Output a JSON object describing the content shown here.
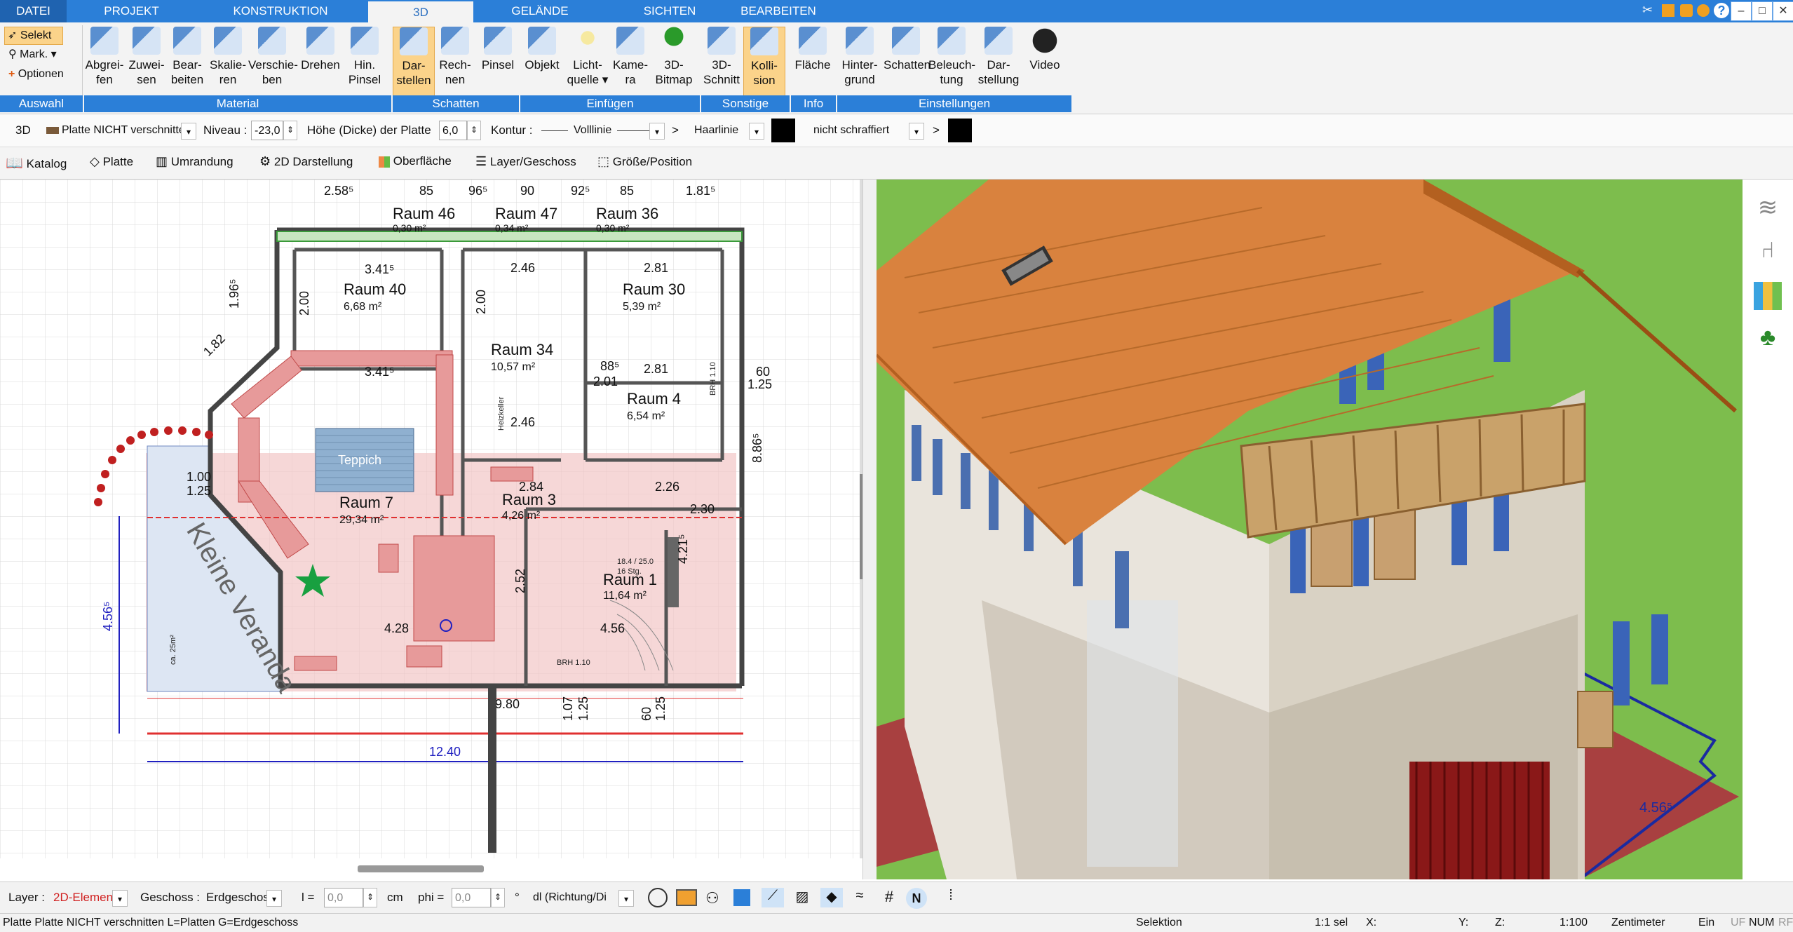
{
  "tabs": [
    "DATEI",
    "PROJEKT",
    "KONSTRUKTION",
    "3D",
    "GELÄNDE",
    "SICHTEN",
    "BEARBEITEN"
  ],
  "active_tab": "3D",
  "window_controls": [
    "–",
    "□",
    "✕"
  ],
  "ribbon": {
    "select": {
      "selekt": "Selekt",
      "mark": "Mark. ▾",
      "optionen": "Optionen"
    },
    "buttons": [
      {
        "l1": "Abgrei-",
        "l2": "fen",
        "icon": "pipette-icon"
      },
      {
        "l1": "Zuwei-",
        "l2": "sen",
        "icon": "assign-icon"
      },
      {
        "l1": "Bear-",
        "l2": "beiten",
        "icon": "edit-icon"
      },
      {
        "l1": "Skalie-",
        "l2": "ren",
        "icon": "scale-icon"
      },
      {
        "l1": "Verschie-",
        "l2": "ben",
        "icon": "move-icon"
      },
      {
        "l1": "Drehen",
        "l2": "",
        "icon": "rotate-icon"
      },
      {
        "l1": "Hin.",
        "l2": "Pinsel",
        "icon": "brush-icon"
      },
      {
        "l1": "Dar-",
        "l2": "stellen",
        "icon": "display-icon"
      },
      {
        "l1": "Rech-",
        "l2": "nen",
        "icon": "calculate-icon"
      },
      {
        "l1": "Pinsel",
        "l2": "",
        "icon": "paint-icon"
      },
      {
        "l1": "Objekt",
        "l2": "",
        "icon": "chair-icon"
      },
      {
        "l1": "Licht-",
        "l2": "quelle ▾",
        "icon": "bulb-icon"
      },
      {
        "l1": "Kame-",
        "l2": "ra",
        "icon": "camera-icon"
      },
      {
        "l1": "3D-",
        "l2": "Bitmap",
        "icon": "tree-icon"
      },
      {
        "l1": "3D-",
        "l2": "Schnitt",
        "icon": "section-icon"
      },
      {
        "l1": "Kolli-",
        "l2": "sion",
        "icon": "collision-icon"
      },
      {
        "l1": "Fläche",
        "l2": "",
        "icon": "area-icon"
      },
      {
        "l1": "Hinter-",
        "l2": "grund",
        "icon": "background-icon"
      },
      {
        "l1": "Schatten",
        "l2": "",
        "icon": "shadow-icon"
      },
      {
        "l1": "Beleuch-",
        "l2": "tung",
        "icon": "lighting-icon"
      },
      {
        "l1": "Dar-",
        "l2": "stellung",
        "icon": "monitor-icon"
      },
      {
        "l1": "Video",
        "l2": "",
        "icon": "play-icon"
      }
    ],
    "groups": [
      "Auswahl",
      "Material",
      "Schatten",
      "Einfügen",
      "Sonstige",
      "Info",
      "Einstellungen"
    ]
  },
  "bar2": {
    "mode": "3D",
    "platte": "Platte NICHT verschnitten",
    "niveau_label": "Niveau :",
    "niveau_value": "-23,0",
    "hoehe_label": "Höhe (Dicke) der Platte",
    "hoehe_value": "6,0",
    "kontur_label": "Kontur :",
    "vollinie": "Volllinie",
    "arrow1": ">",
    "haarlinie": "Haarlinie",
    "schraffiert": "nicht schraffiert",
    "arrow2": ">"
  },
  "bar3": [
    "Katalog",
    "Platte",
    "Umrandung",
    "2D Darstellung",
    "Oberfläche",
    "Layer/Geschoss",
    "Größe/Position"
  ],
  "plan": {
    "rooms": [
      {
        "name": "Raum 40",
        "area": "6,68 m²"
      },
      {
        "name": "Raum 30",
        "area": "5,39 m²"
      },
      {
        "name": "Raum 34",
        "area": "10,57 m²"
      },
      {
        "name": "Raum 4",
        "area": "6,54 m²"
      },
      {
        "name": "Raum 7",
        "area": "29,34 m²"
      },
      {
        "name": "Raum 3",
        "area": "4,26 m²"
      },
      {
        "name": "Raum 1",
        "area": "11,64 m²"
      },
      {
        "name": "Raum 46",
        "area": "0,30 m²"
      },
      {
        "name": "Raum 47",
        "area": "0,34 m²"
      },
      {
        "name": "Raum 36",
        "area": "0,30 m²"
      }
    ],
    "dims_top": [
      "2.58⁵",
      "85",
      "96⁵",
      "90",
      "92⁵",
      "85",
      "1.81⁵"
    ],
    "dims": [
      "3.41⁵",
      "2.46",
      "2.81",
      "3.41⁵",
      "2.46",
      "2.81",
      "2.84",
      "2.26",
      "2.30",
      "4.28",
      "4.56",
      "9.80",
      "12.40",
      "4.56⁵",
      "1.96⁵",
      "1.82",
      "2.00",
      "2.00",
      "1.00",
      "1.25",
      "60",
      "1.25",
      "8.86⁵",
      "1.07",
      "1.25",
      "60",
      "1.25",
      "2.01",
      "88⁵",
      "2.52",
      "4.21⁵"
    ],
    "labels": [
      "Teppich",
      "Kleine Veranda",
      "BRH 1.10",
      "BRH 1.10",
      "Heizkeller",
      "ca. 25m²",
      "18.4 / 25.0",
      "16 Stg."
    ],
    "blue_dim": "4.56⁵"
  },
  "view3d": {
    "dim_label": "4.56⁵"
  },
  "side_icons": [
    "layers-icon",
    "chair-icon",
    "palette-icon",
    "tree-icon"
  ],
  "bottom": {
    "layer_label": "Layer :",
    "layer_value": "2D-Elemen",
    "geschoss_label": "Geschoss :",
    "geschoss_value": "Erdgeschos",
    "l_label": "l =",
    "l_value": "0,0",
    "cm": "cm",
    "phi_label": "phi =",
    "phi_value": "0,0",
    "deg": "°",
    "richtung": "dl (Richtung/Di"
  },
  "status": {
    "message": "Platte Platte NICHT verschnitten L=Platten G=Erdgeschoss",
    "selektion": "Selektion",
    "sel": "1:1 sel",
    "x": "X:",
    "y": "Y:",
    "z": "Z:",
    "scale": "1:100",
    "unit": "Zentimeter",
    "ein": "Ein",
    "uf": "UF",
    "num": "NUM",
    "rf": "RF"
  },
  "colors": {
    "accent": "#2b7fd8",
    "active_button": "#fbd38a",
    "wall_highlight": "#e8a0a0",
    "roof": "#d9823e",
    "grass": "#7fc34c"
  }
}
